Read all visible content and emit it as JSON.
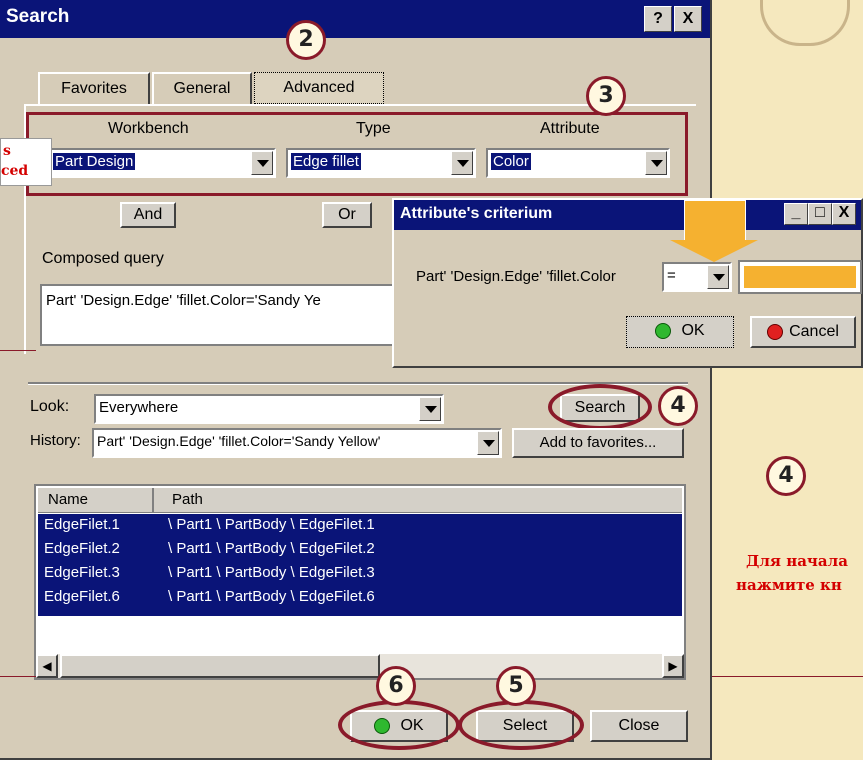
{
  "dialog": {
    "title": "Search",
    "help_btn": "?",
    "close_btn": "X",
    "tabs": [
      "Favorites",
      "General",
      "Advanced"
    ],
    "columns": {
      "workbench": "Workbench",
      "type": "Type",
      "attribute": "Attribute"
    },
    "workbench_value": "Part Design",
    "type_value": "Edge fillet",
    "attribute_value": "Color",
    "and_label": "And",
    "or_label": "Or",
    "composed_label": "Composed query",
    "composed_value": "Part' 'Design.Edge' 'fillet.Color='Sandy Ye",
    "look_label": "Look:",
    "look_value": "Everywhere",
    "search_btn": "Search",
    "history_label": "History:",
    "history_value": "Part' 'Design.Edge' 'fillet.Color='Sandy Yellow'",
    "add_fav_btn": "Add to favorites...",
    "table_headers": [
      "Name",
      "Path"
    ],
    "rows": [
      {
        "name": "EdgeFilet.1",
        "path": "\\ Part1 \\ PartBody \\ EdgeFilet.1"
      },
      {
        "name": "EdgeFilet.2",
        "path": "\\ Part1 \\ PartBody \\ EdgeFilet.2"
      },
      {
        "name": "EdgeFilet.3",
        "path": "\\ Part1 \\ PartBody \\ EdgeFilet.3"
      },
      {
        "name": "EdgeFilet.6",
        "path": "\\ Part1 \\ PartBody \\ EdgeFilet.6"
      }
    ],
    "ok_btn": "OK",
    "select_btn": "Select",
    "close_label": "Close"
  },
  "popup": {
    "title": "Attribute's criterium",
    "label": "Part' 'Design.Edge' 'fillet.Color",
    "operator": "=",
    "ok_btn": "OK",
    "cancel_btn": "Cancel"
  },
  "callouts": {
    "c2": "2",
    "c3": "3",
    "c4": "4",
    "c4b": "4",
    "c5": "5",
    "c6": "6"
  },
  "side_text": {
    "left_1": "s",
    "left_2": "ced",
    "right_1": "Для начала",
    "right_2": "нажмите кн"
  },
  "colors": {
    "title_bar": "#0a1478",
    "selection": "#0a1478",
    "callout_ring": "#8a1a2a",
    "annotation": "#d40000",
    "value_orange": "#f5b130"
  }
}
